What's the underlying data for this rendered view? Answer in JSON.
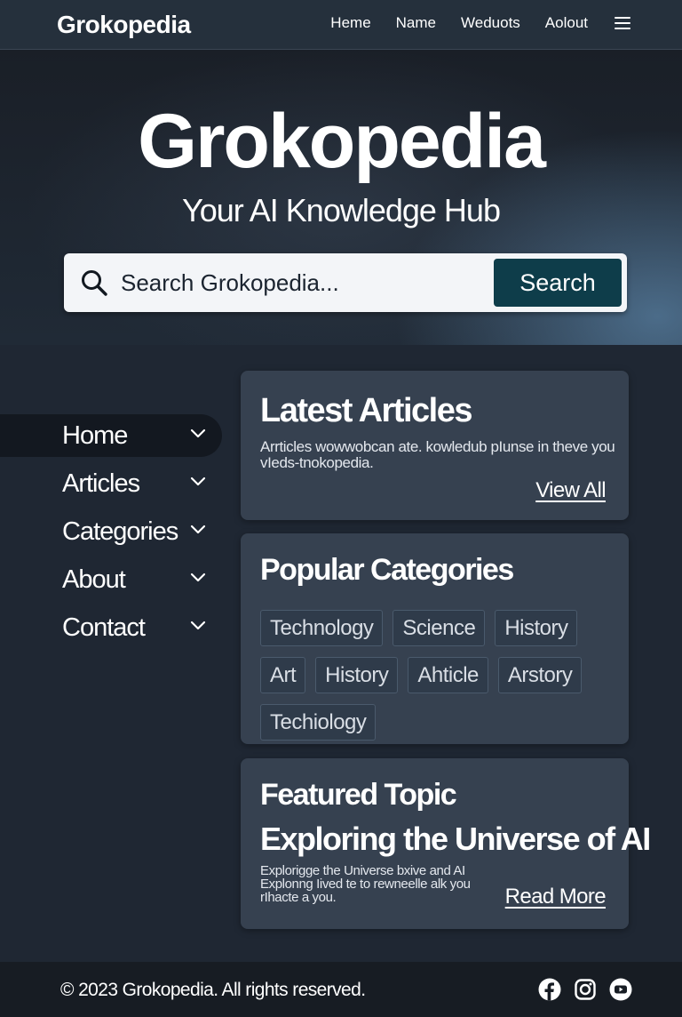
{
  "header": {
    "brand": "Grokopedia",
    "nav": [
      "Heme",
      "Name",
      "Weduots",
      "Aolout"
    ]
  },
  "hero": {
    "title": "Grokopedia",
    "subtitle": "Your AI Knowledge Hub",
    "search_placeholder": "Search Grokopedia...",
    "search_button": "Search"
  },
  "sidebar": {
    "items": [
      {
        "label": "Home",
        "active": true
      },
      {
        "label": "Articles",
        "active": false
      },
      {
        "label": "Categories",
        "active": false
      },
      {
        "label": "About",
        "active": false
      },
      {
        "label": "Contact",
        "active": false
      }
    ]
  },
  "latest": {
    "title": "Latest Articles",
    "description": "Arrticles wowwobcan ate. kowledub pIunse in theve you vIeds-tnokopedia.",
    "link": "View All"
  },
  "popular": {
    "title": "Popular Categories",
    "tags": [
      "Technology",
      "Science",
      "History",
      "Art",
      "History",
      "Ahticle",
      "Arstory",
      "Techiology"
    ]
  },
  "featured": {
    "title": "Featured Topic",
    "headline": "Exploring the Universe of AI",
    "description": "Explorigge the Universe bxive and AI Explonng Iived te to rewneelle alk you rIhacte a you.",
    "link": "Read More"
  },
  "footer": {
    "copyright": "© 2023 Grokopedia. All rights reserved.",
    "socials": [
      "facebook-icon",
      "instagram-icon",
      "youtube-icon"
    ]
  }
}
